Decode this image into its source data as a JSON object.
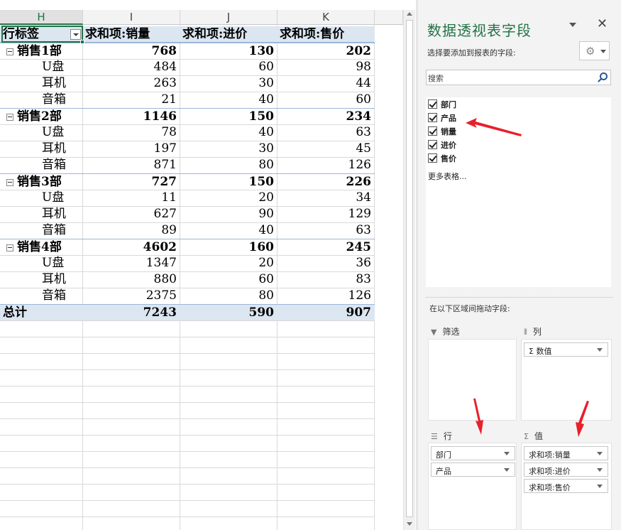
{
  "sheet": {
    "columns": [
      "H",
      "I",
      "J",
      "K"
    ],
    "active_column": "H",
    "header": [
      "行标签",
      "求和项:销量",
      "求和项:进价",
      "求和项:售价"
    ],
    "rows": [
      {
        "type": "group",
        "label": "销售1部",
        "v1": "768",
        "v2": "130",
        "v3": "202"
      },
      {
        "type": "item",
        "label": "U盘",
        "v1": "484",
        "v2": "60",
        "v3": "98"
      },
      {
        "type": "item",
        "label": "耳机",
        "v1": "263",
        "v2": "30",
        "v3": "44"
      },
      {
        "type": "item",
        "label": "音箱",
        "v1": "21",
        "v2": "40",
        "v3": "60"
      },
      {
        "type": "group",
        "label": "销售2部",
        "v1": "1146",
        "v2": "150",
        "v3": "234"
      },
      {
        "type": "item",
        "label": "U盘",
        "v1": "78",
        "v2": "40",
        "v3": "63"
      },
      {
        "type": "item",
        "label": "耳机",
        "v1": "197",
        "v2": "30",
        "v3": "45"
      },
      {
        "type": "item",
        "label": "音箱",
        "v1": "871",
        "v2": "80",
        "v3": "126"
      },
      {
        "type": "group",
        "label": "销售3部",
        "v1": "727",
        "v2": "150",
        "v3": "226"
      },
      {
        "type": "item",
        "label": "U盘",
        "v1": "11",
        "v2": "20",
        "v3": "34"
      },
      {
        "type": "item",
        "label": "耳机",
        "v1": "627",
        "v2": "90",
        "v3": "129"
      },
      {
        "type": "item",
        "label": "音箱",
        "v1": "89",
        "v2": "40",
        "v3": "63"
      },
      {
        "type": "group",
        "label": "销售4部",
        "v1": "4602",
        "v2": "160",
        "v3": "245"
      },
      {
        "type": "item",
        "label": "U盘",
        "v1": "1347",
        "v2": "20",
        "v3": "36"
      },
      {
        "type": "item",
        "label": "耳机",
        "v1": "880",
        "v2": "60",
        "v3": "83"
      },
      {
        "type": "item",
        "label": "音箱",
        "v1": "2375",
        "v2": "80",
        "v3": "126"
      }
    ],
    "total": {
      "label": "总计",
      "v1": "7243",
      "v2": "590",
      "v3": "907"
    }
  },
  "pane": {
    "title": "数据透视表字段",
    "prompt": "选择要添加到报表的字段:",
    "search_placeholder": "搜索",
    "fields": [
      {
        "label": "部门",
        "checked": true
      },
      {
        "label": "产品",
        "checked": true
      },
      {
        "label": "销量",
        "checked": true
      },
      {
        "label": "进价",
        "checked": true
      },
      {
        "label": "售价",
        "checked": true
      }
    ],
    "more_tables": "更多表格...",
    "drag_hint": "在以下区域间拖动字段:",
    "areas": {
      "filter": {
        "label": "筛选",
        "icon": "filter-icon",
        "items": []
      },
      "columns": {
        "label": "列",
        "icon": "columns-icon",
        "items": [
          "Σ 数值"
        ]
      },
      "rows": {
        "label": "行",
        "icon": "rows-icon",
        "items": [
          "部门",
          "产品"
        ]
      },
      "values": {
        "label": "值",
        "icon": "sigma-icon",
        "items": [
          "求和项:销量",
          "求和项:进价",
          "求和项:售价"
        ]
      }
    }
  },
  "colors": {
    "accent": "#217346",
    "pivot_header_fill": "#dce6f1",
    "annotation_arrow": "#e8202a"
  }
}
